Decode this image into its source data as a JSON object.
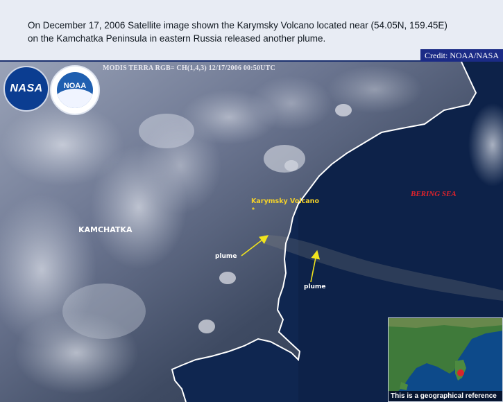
{
  "caption": {
    "line1": "On December 17, 2006 Satellite image shown the Karymsky Volcano located near (54.05N, 159.45E)",
    "line2": "on the Kamchatka Peninsula in eastern Russia released another plume."
  },
  "credit": "Credit: NOAA/NASA",
  "image_header": "MODIS TERRA  RGB= CH(1,4,3) 12/17/2006 00:50UTC",
  "logos": {
    "nasa": "NASA",
    "noaa": "NOAA"
  },
  "labels": {
    "bering_sea": "BERING SEA",
    "kamchatka": "KAMCHATKA",
    "volcano": "Karymsky Volcano",
    "volcano_marker": "*",
    "plume_left": "plume",
    "plume_right": "plume"
  },
  "inset": {
    "caption": "This is a geographical reference"
  },
  "colors": {
    "caption_bg": "#e8ecf4",
    "credit_bg": "#1b2b86",
    "ocean": "#0f2650",
    "coastline": "#ffffff",
    "volcano_label": "#f3d12a",
    "sea_label": "#e3232b",
    "arrow": "#f1e41d",
    "inset_marker": "#d8262b"
  },
  "icons": {
    "nasa_logo": "nasa-logo-icon",
    "noaa_logo": "noaa-logo-icon",
    "volcano_marker": "asterisk-icon"
  }
}
